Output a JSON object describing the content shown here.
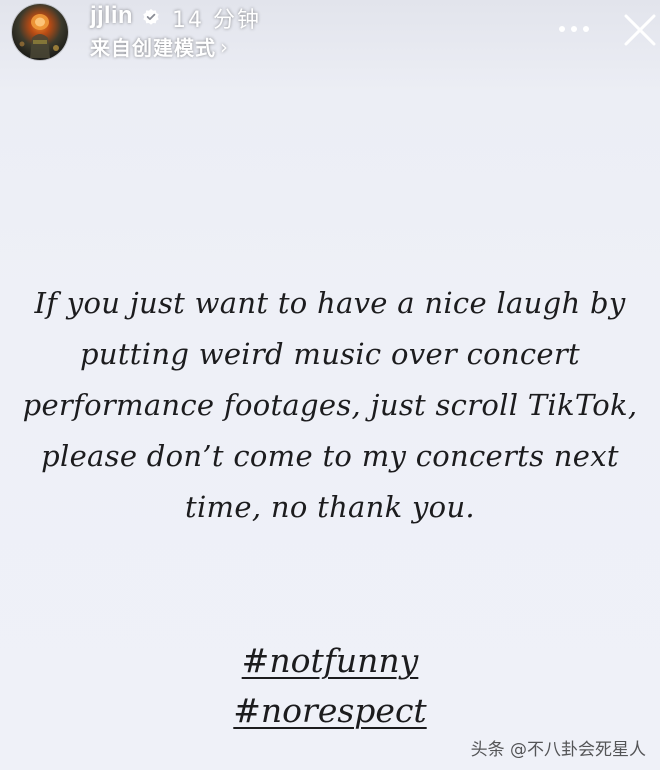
{
  "header": {
    "username": "jjlin",
    "time": "14 分钟",
    "subtitle": "来自创建模式",
    "subtitle_chevron": "›",
    "avatar_icon": "avatar-photo",
    "verified_icon": "verified-badge-icon",
    "more_icon": "more-horizontal-icon",
    "close_icon": "close-icon"
  },
  "story": {
    "message": "If you just want to have a nice laugh by putting weird music over concert performance footages, just scroll TikTok, please don’t come to my concerts next time, no thank you.",
    "hashtags": [
      "#notfunny",
      "#norespect"
    ]
  },
  "watermark": "头条 @不八卦会死星人",
  "colors": {
    "background": "#eef0f7",
    "text": "#1c1c1e",
    "header_text": "#ffffff"
  }
}
